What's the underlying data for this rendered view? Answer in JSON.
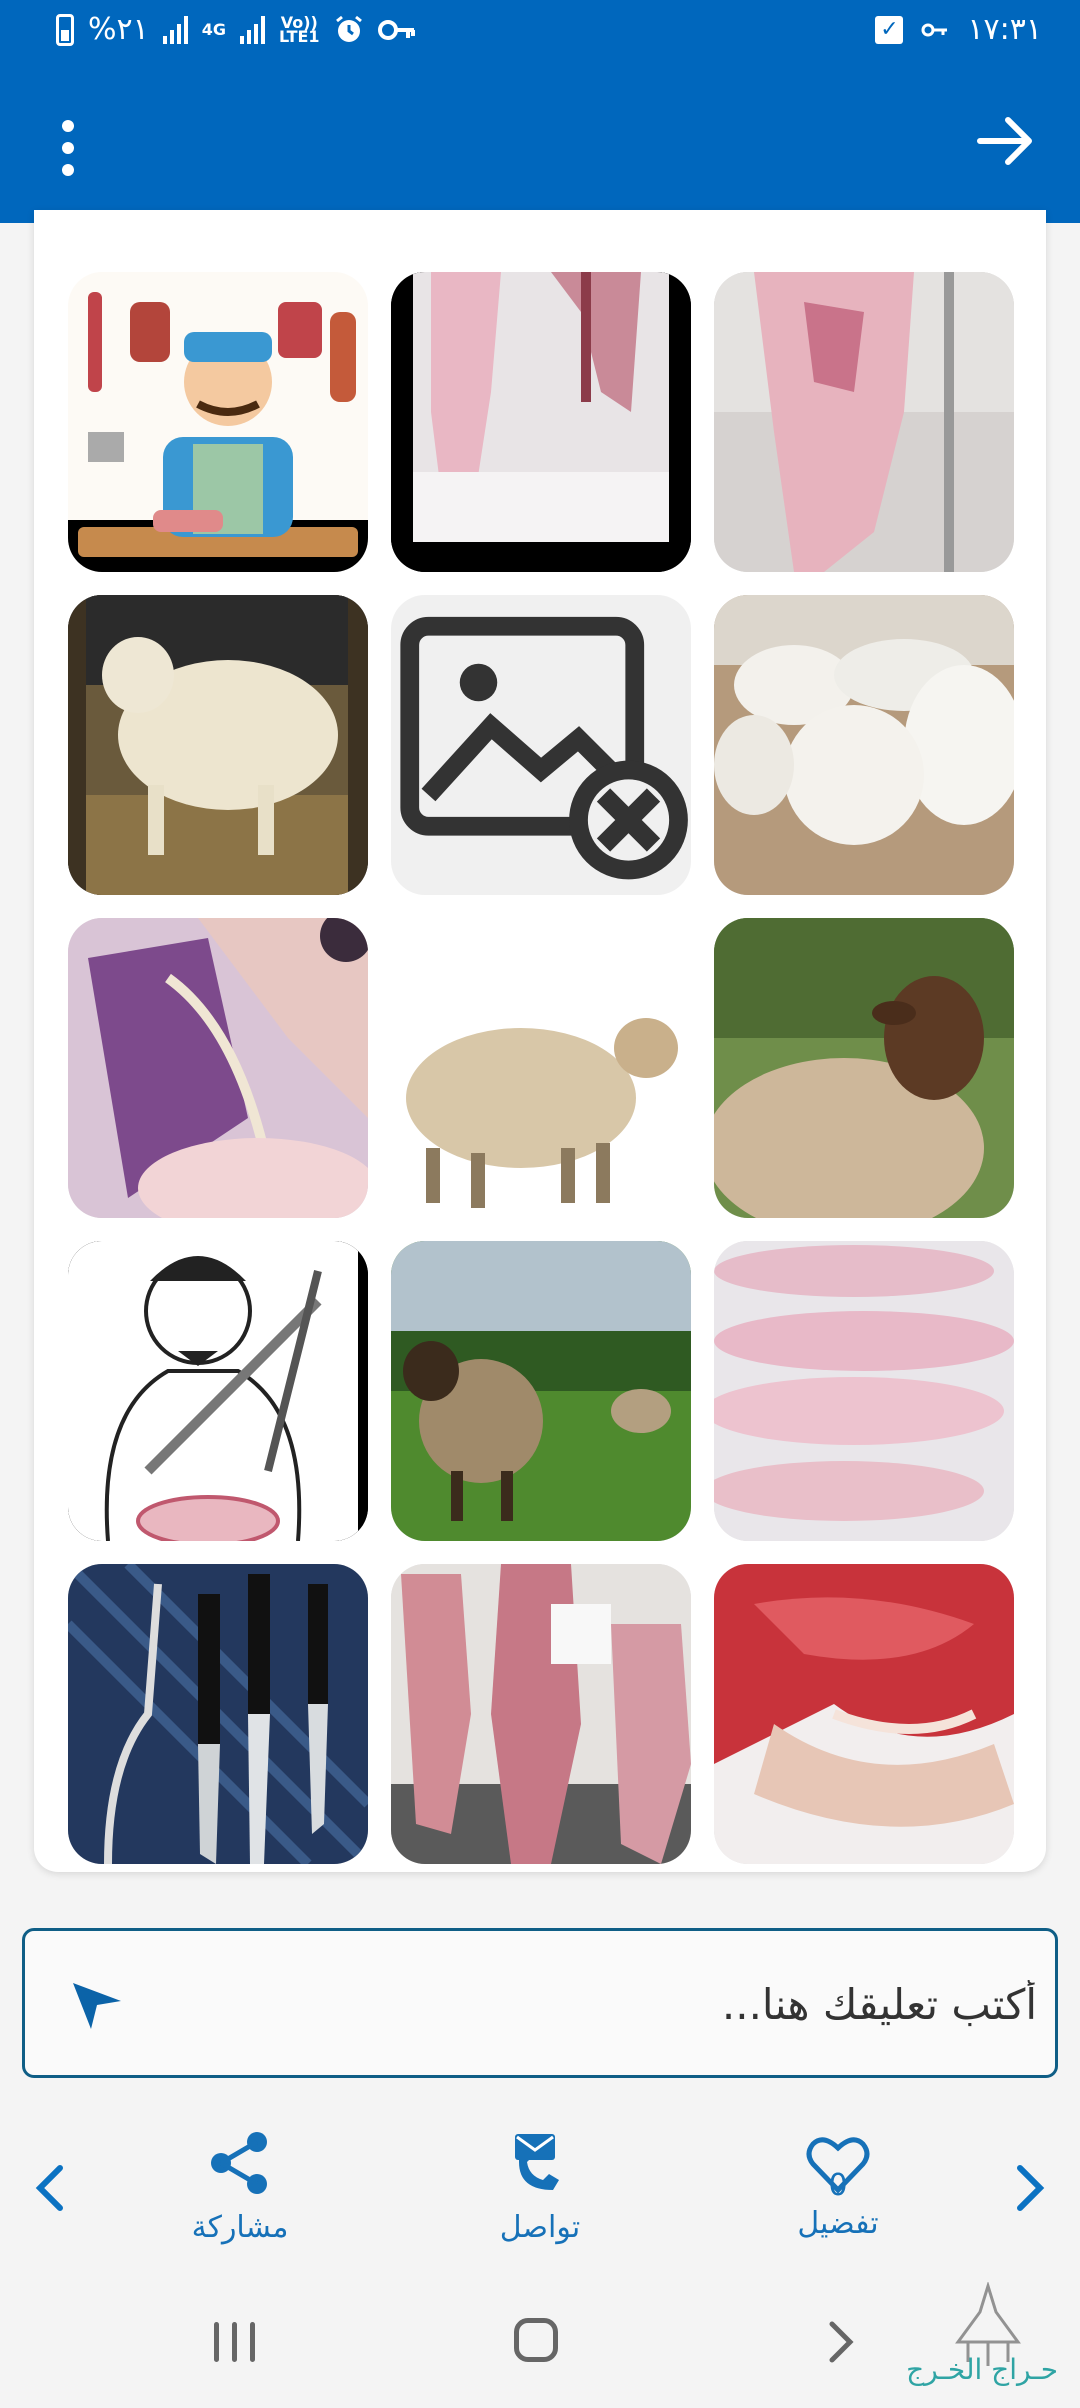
{
  "status_bar": {
    "time": "١٧:٣١",
    "battery": "%٢١",
    "network": "4G",
    "volte": "Vo))",
    "lte": "LTE1"
  },
  "app_bar": {
    "menu_icon": "more-vert-icon",
    "back_icon": "arrow-forward-icon"
  },
  "gallery": {
    "images": [
      {
        "subject": "butcher-cartoon"
      },
      {
        "subject": "hanging-carcass"
      },
      {
        "subject": "hanging-carcass-closeup"
      },
      {
        "subject": "white-sheep-in-pen"
      },
      {
        "subject": "broken-image"
      },
      {
        "subject": "flock-of-white-sheep"
      },
      {
        "subject": "meat-closeup"
      },
      {
        "subject": "sheep-on-white"
      },
      {
        "subject": "brown-head-sheep"
      },
      {
        "subject": "chef-cartoon-knives"
      },
      {
        "subject": "sheep-in-field"
      },
      {
        "subject": "carcasses-on-table"
      },
      {
        "subject": "knives-and-hook"
      },
      {
        "subject": "carcasses-in-slaughterhouse"
      },
      {
        "subject": "raw-meat-closeup"
      }
    ]
  },
  "comment": {
    "placeholder": "أكتب تعليقك هنا..."
  },
  "actions": {
    "favorite_label": "تفضيل",
    "favorite_count": "0",
    "contact_label": "تواصل",
    "share_label": "مشاركة"
  },
  "watermark": {
    "text": "حـراج الخـرج"
  },
  "colors": {
    "primary": "#0067bd",
    "accent": "#1671b8",
    "border": "#0f5e86"
  }
}
